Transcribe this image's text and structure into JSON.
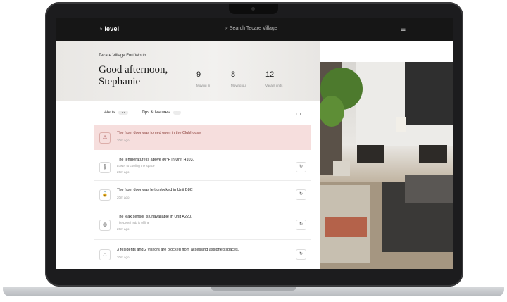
{
  "topbar": {
    "logo": "level",
    "search_placeholder": "Search Tecare Village"
  },
  "hero": {
    "community": "Tecare Village Fort Worth",
    "greeting": "Good afternoon, Stephanie",
    "stats": [
      {
        "value": "9",
        "label": "Moving in"
      },
      {
        "value": "8",
        "label": "Moving out"
      },
      {
        "value": "12",
        "label": "Vacant units"
      }
    ]
  },
  "tabs": [
    {
      "label": "Alerts",
      "count": "22"
    },
    {
      "label": "Tips & features",
      "count": "1"
    }
  ],
  "alerts": [
    {
      "title": "The front door was forced open in the Clubhouse",
      "time": "20m ago"
    },
    {
      "title": "The temperature is above 80°F in Unit H103.",
      "sub": "Lower to cooling the space",
      "time": "20m ago"
    },
    {
      "title": "The front door was left unlocked in Unit B8C",
      "time": "20m ago"
    },
    {
      "title": "The leak sensor is unavailable in Unit A220.",
      "sub": "The Level hub is offline",
      "time": "20m ago"
    },
    {
      "title": "3 residents and 2 visitors are blocked from accessing assigned spaces.",
      "time": "20m ago"
    }
  ],
  "icons": {
    "logo": "level-logo-icon",
    "search": "search-icon",
    "menu": "menu-icon",
    "calendar": "calendar-icon"
  },
  "colors": {
    "topbar": "#161616",
    "danger_bg": "#f6dedd",
    "danger_text": "#8a3b36"
  }
}
